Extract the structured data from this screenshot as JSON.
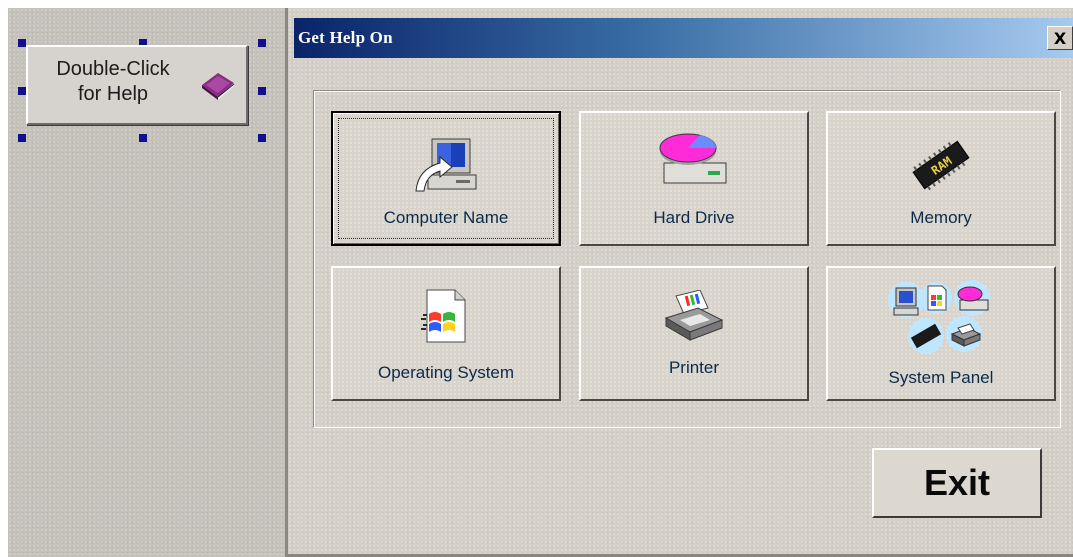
{
  "help_button": {
    "label_line1": "Double-Click",
    "label_line2": "for Help",
    "icon": "book-icon"
  },
  "dialog": {
    "title": "Get Help On",
    "close_label": "X",
    "tiles": [
      {
        "label": "Computer Name",
        "icon": "computer-icon",
        "focused": true
      },
      {
        "label": "Hard Drive",
        "icon": "hard-drive-icon",
        "focused": false
      },
      {
        "label": "Memory",
        "icon": "memory-chip-icon",
        "focused": false
      },
      {
        "label": "Operating System",
        "icon": "operating-system-icon",
        "focused": false
      },
      {
        "label": "Printer",
        "icon": "printer-icon",
        "focused": false
      },
      {
        "label": "System Panel",
        "icon": "system-panel-icon",
        "focused": false
      }
    ],
    "exit_label": "Exit"
  },
  "chip_text": "RAM",
  "colors": {
    "title_gradient_start": "#0a246a",
    "title_gradient_end": "#a6caf0",
    "handle": "#10108c",
    "label_text": "#0b2a4a"
  }
}
